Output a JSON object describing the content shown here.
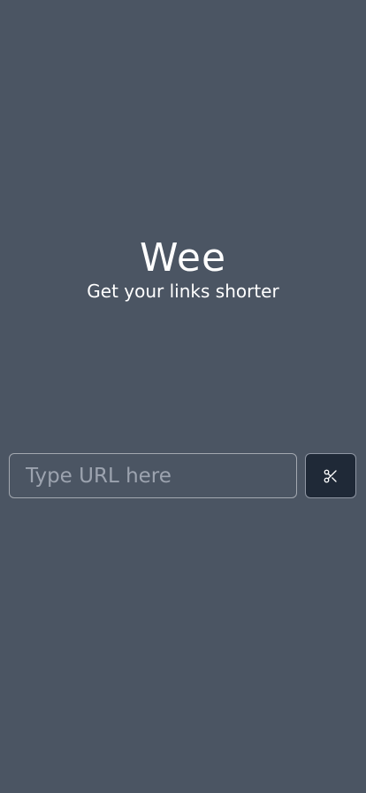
{
  "brand": {
    "title": "Wee",
    "subtitle": "Get your links shorter"
  },
  "url_form": {
    "placeholder": "Type URL here",
    "value": "",
    "submit_icon": "scissors-icon"
  },
  "colors": {
    "background": "#4b5563",
    "text": "#ffffff",
    "button_background": "#1f2937",
    "input_border": "#a3a8b0",
    "placeholder": "#9ca3af"
  }
}
